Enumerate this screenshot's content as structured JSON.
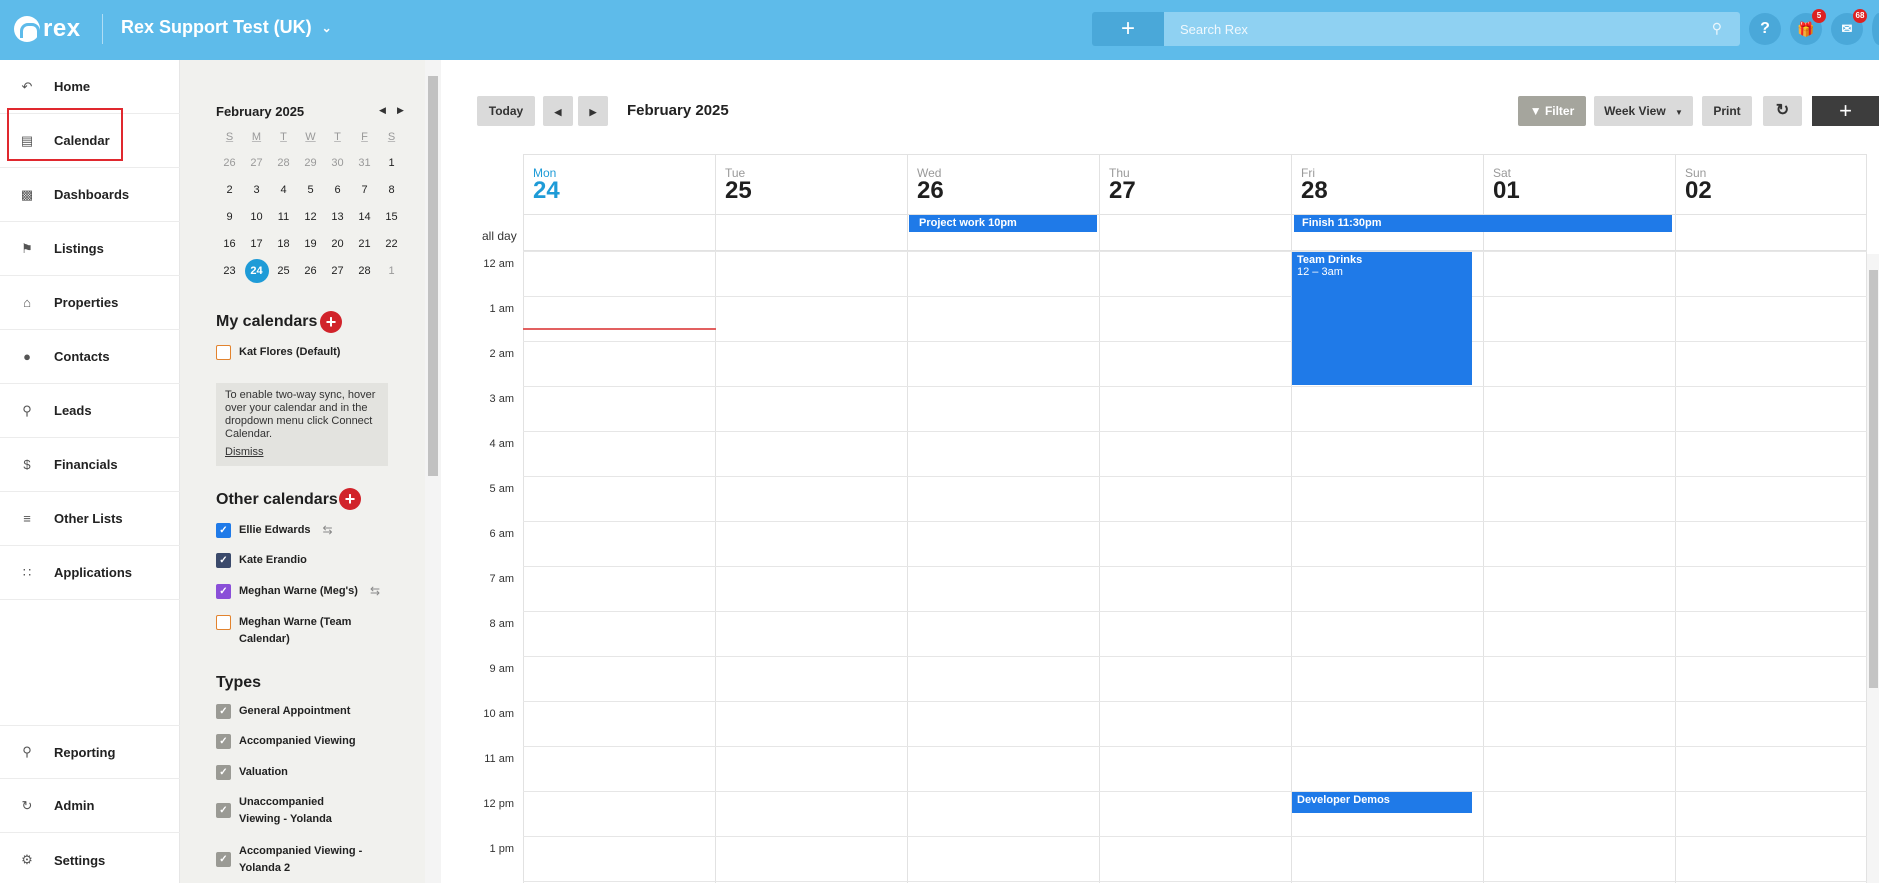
{
  "topbar": {
    "logo_text": "rex",
    "account_name": "Rex Support Test (UK)",
    "search_placeholder": "Search Rex",
    "help_label": "?",
    "gifts_badge": "5",
    "inbox_badge": "68"
  },
  "nav": {
    "items": [
      {
        "label": "Home",
        "icon": "home-icon"
      },
      {
        "label": "Calendar",
        "icon": "calendar-icon"
      },
      {
        "label": "Dashboards",
        "icon": "dashboard-icon"
      },
      {
        "label": "Listings",
        "icon": "sign-icon"
      },
      {
        "label": "Properties",
        "icon": "house-icon"
      },
      {
        "label": "Contacts",
        "icon": "person-icon"
      },
      {
        "label": "Leads",
        "icon": "lead-icon"
      },
      {
        "label": "Financials",
        "icon": "dollar-icon"
      },
      {
        "label": "Other Lists",
        "icon": "list-icon"
      },
      {
        "label": "Applications",
        "icon": "grid-icon"
      }
    ],
    "bottom": [
      {
        "label": "Reporting",
        "icon": "report-icon"
      },
      {
        "label": "Admin",
        "icon": "admin-icon"
      },
      {
        "label": "Settings",
        "icon": "gear-icon"
      }
    ]
  },
  "mini_calendar": {
    "title": "February 2025",
    "weekdays": [
      "S",
      "M",
      "T",
      "W",
      "T",
      "F",
      "S"
    ],
    "weeks": [
      [
        "26",
        "27",
        "28",
        "29",
        "30",
        "31",
        "1"
      ],
      [
        "2",
        "3",
        "4",
        "5",
        "6",
        "7",
        "8"
      ],
      [
        "9",
        "10",
        "11",
        "12",
        "13",
        "14",
        "15"
      ],
      [
        "16",
        "17",
        "18",
        "19",
        "20",
        "21",
        "22"
      ],
      [
        "23",
        "24",
        "25",
        "26",
        "27",
        "28",
        "1"
      ]
    ]
  },
  "my_calendars": {
    "title": "My calendars",
    "items": [
      {
        "label": "Kat Flores (Default)"
      }
    ],
    "notice": "To enable two-way sync, hover over your calendar and in the dropdown menu click Connect Calendar.",
    "dismiss": "Dismiss"
  },
  "other_calendars": {
    "title": "Other calendars",
    "items": [
      {
        "label": "Ellie Edwards",
        "color": "#1f7ae8"
      },
      {
        "label": "Kate Erandio",
        "color": "#3b4a6b"
      },
      {
        "label": "Meghan Warne (Meg's)",
        "color": "#8a4fd8"
      },
      {
        "label": "Meghan Warne (Team Calendar)",
        "color": "#e2832e"
      }
    ]
  },
  "types": {
    "title": "Types",
    "items": [
      {
        "label": "General Appointment"
      },
      {
        "label": "Accompanied Viewing"
      },
      {
        "label": "Valuation"
      },
      {
        "label": "Unaccompanied Viewing - Yolanda"
      },
      {
        "label": "Accompanied Viewing - Yolanda 2"
      }
    ]
  },
  "toolbar": {
    "today": "Today",
    "month_title": "February 2025",
    "filter": "Filter",
    "view": "Week View",
    "print": "Print"
  },
  "week": {
    "days": [
      {
        "name": "Mon",
        "num": "24"
      },
      {
        "name": "Tue",
        "num": "25"
      },
      {
        "name": "Wed",
        "num": "26"
      },
      {
        "name": "Thu",
        "num": "27"
      },
      {
        "name": "Fri",
        "num": "28"
      },
      {
        "name": "Sat",
        "num": "01"
      },
      {
        "name": "Sun",
        "num": "02"
      }
    ],
    "all_day_label": "all day",
    "hours": [
      "12 am",
      "1 am",
      "2 am",
      "3 am",
      "4 am",
      "5 am",
      "6 am",
      "7 am",
      "8 am",
      "9 am",
      "10 am",
      "11 am",
      "12 pm",
      "1 pm"
    ],
    "events": {
      "project_work": "Project work 10pm",
      "finish": "Finish 11:30pm",
      "team_drinks_title": "Team Drinks",
      "team_drinks_time": "12 – 3am",
      "developer_demos": "Developer Demos"
    }
  }
}
